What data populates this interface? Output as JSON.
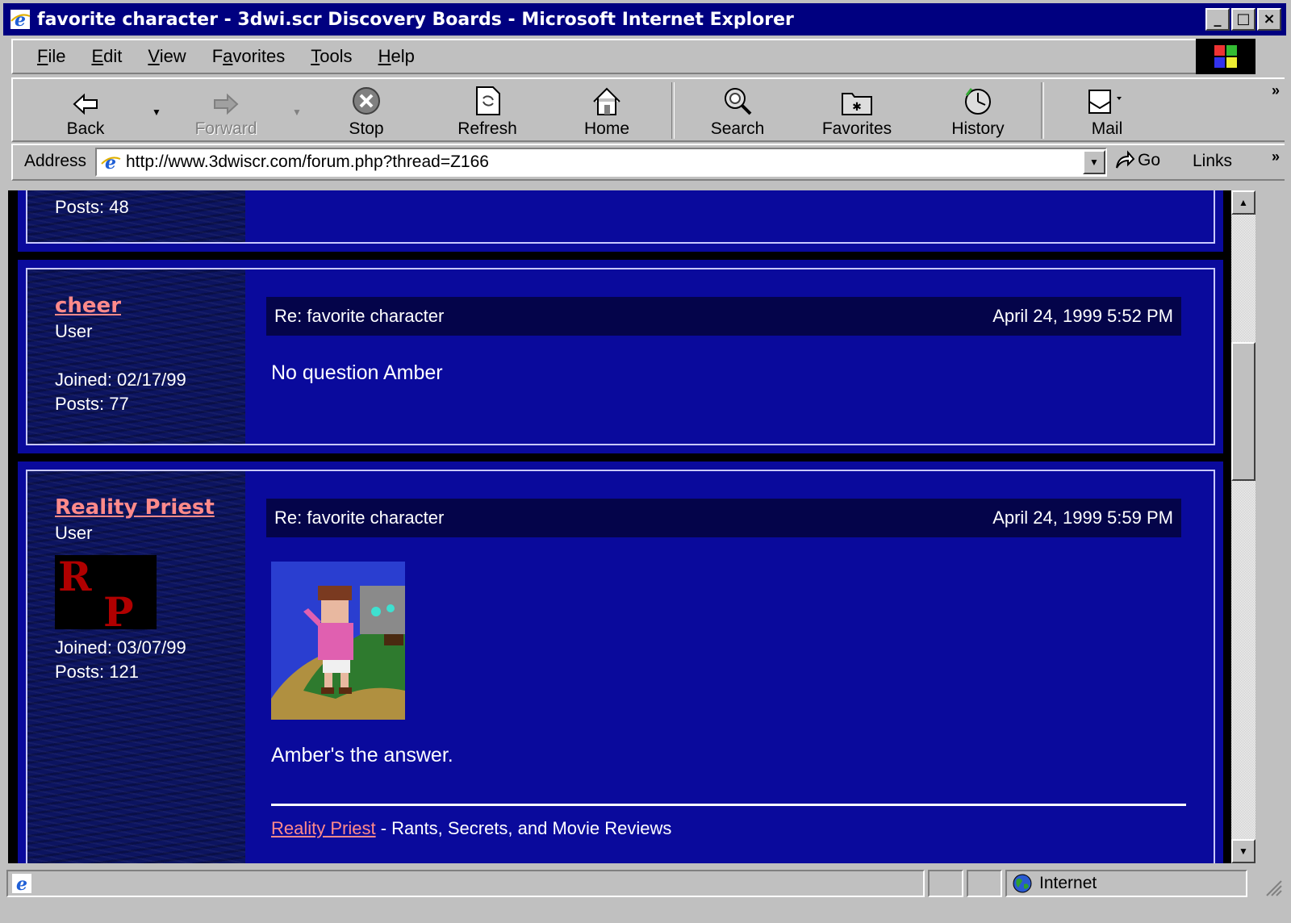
{
  "window": {
    "title": "favorite character - 3dwi.scr Discovery Boards - Microsoft Internet Explorer",
    "minimize": "_",
    "maximize": "□",
    "close": "×"
  },
  "menu": [
    "File",
    "Edit",
    "View",
    "Favorites",
    "Tools",
    "Help"
  ],
  "menu_hotkeys": [
    "F",
    "E",
    "V",
    "a",
    "T",
    "H"
  ],
  "toolbar": {
    "back": "Back",
    "forward": "Forward",
    "stop": "Stop",
    "refresh": "Refresh",
    "home": "Home",
    "search": "Search",
    "favorites": "Favorites",
    "history": "History",
    "mail": "Mail",
    "more": "»"
  },
  "address": {
    "label": "Address",
    "url": "http://www.3dwiscr.com/forum.php?thread=Z166",
    "go": "Go",
    "links": "Links",
    "links_more": "»"
  },
  "posts": [
    {
      "posts_text": "Posts: 48"
    },
    {
      "username": "cheer",
      "role": "User",
      "joined": "Joined: 02/17/99",
      "posts_text": "Posts: 77",
      "subject": "Re: favorite character",
      "date": "April 24, 1999 5:52 PM",
      "body": "No question Amber"
    },
    {
      "username": "Reality Priest",
      "role": "User",
      "avatar_text": "RP",
      "joined": "Joined: 03/07/99",
      "posts_text": "Posts: 121",
      "subject": "Re: favorite character",
      "date": "April 24, 1999 5:59 PM",
      "body": "Amber's the answer.",
      "signature_link": "Reality Priest",
      "signature_text": " - Rants, Secrets, and Movie Reviews"
    }
  ],
  "status": {
    "zone": "Internet"
  },
  "colors": {
    "title_bar": "#000080",
    "forum_bg": "#0a0a9c",
    "username_link": "#ff8a8a"
  }
}
